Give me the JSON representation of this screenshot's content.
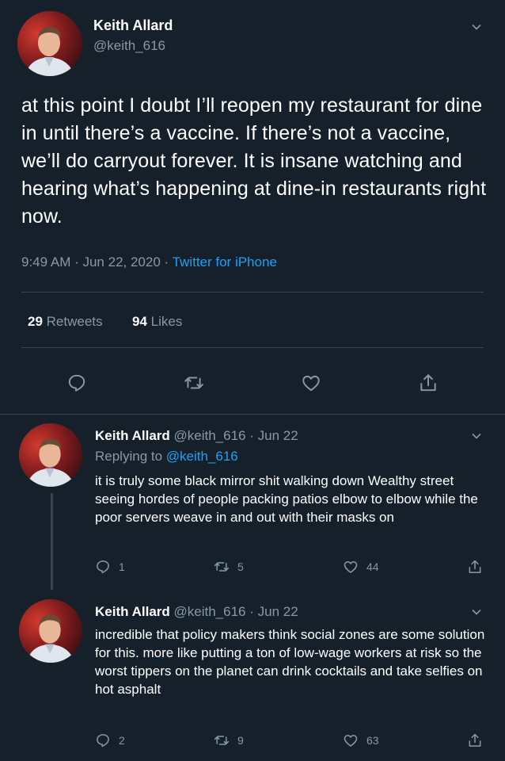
{
  "main": {
    "name": "Keith Allard",
    "handle": "@keith_616",
    "text": "at this point I doubt I’ll reopen my restaurant for dine in until there’s a vaccine. If there’s not a vaccine, we’ll do carryout forever. It is insane watching and hearing what’s happening at dine-in restaurants right now.",
    "time": "9:49 AM · Jun 22, 2020 · ",
    "source": "Twitter for iPhone",
    "retweets_count": "29",
    "retweets_label": "Retweets",
    "likes_count": "94",
    "likes_label": "Likes"
  },
  "replies": [
    {
      "name": "Keith Allard",
      "handle_date": "@keith_616 · Jun 22",
      "replying_prefix": "Replying to ",
      "replying_to": "@keith_616",
      "text": "it is truly some black mirror shit walking down Wealthy street seeing hordes of people packing patios elbow to elbow while the poor servers weave in and out with their masks on",
      "reply_count": "1",
      "retweet_count": "5",
      "like_count": "44"
    },
    {
      "name": "Keith Allard",
      "handle_date": "@keith_616 · Jun 22",
      "text": "incredible that policy makers think social zones are some solution for this. more like putting a ton of low-wage workers at risk so the worst tippers on the planet can drink cocktails and take selfies on hot asphalt",
      "reply_count": "2",
      "retweet_count": "9",
      "like_count": "63"
    }
  ],
  "colors": {
    "background": "#15202b",
    "secondary": "#8899a6",
    "link": "#1da1f2",
    "divider": "#38444d"
  },
  "icons": [
    "chevron-down-icon",
    "reply-icon",
    "retweet-icon",
    "like-icon",
    "share-icon"
  ]
}
